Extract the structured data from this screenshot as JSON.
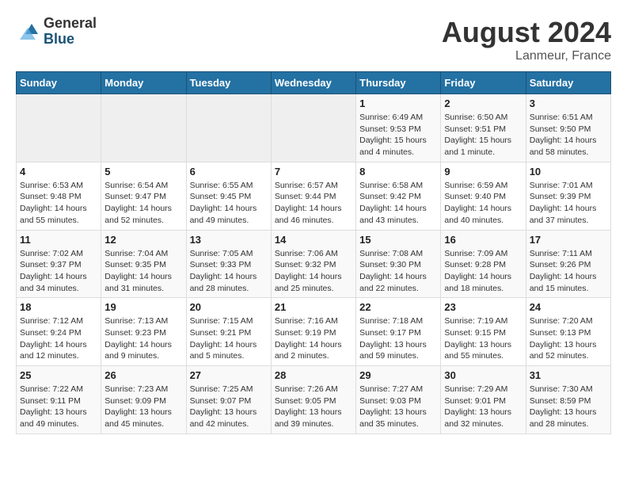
{
  "header": {
    "logo_general": "General",
    "logo_blue": "Blue",
    "month_year": "August 2024",
    "location": "Lanmeur, France"
  },
  "days_of_week": [
    "Sunday",
    "Monday",
    "Tuesday",
    "Wednesday",
    "Thursday",
    "Friday",
    "Saturday"
  ],
  "weeks": [
    {
      "days": [
        {
          "num": "",
          "info": ""
        },
        {
          "num": "",
          "info": ""
        },
        {
          "num": "",
          "info": ""
        },
        {
          "num": "",
          "info": ""
        },
        {
          "num": "1",
          "info": "Sunrise: 6:49 AM\nSunset: 9:53 PM\nDaylight: 15 hours\nand 4 minutes."
        },
        {
          "num": "2",
          "info": "Sunrise: 6:50 AM\nSunset: 9:51 PM\nDaylight: 15 hours\nand 1 minute."
        },
        {
          "num": "3",
          "info": "Sunrise: 6:51 AM\nSunset: 9:50 PM\nDaylight: 14 hours\nand 58 minutes."
        }
      ]
    },
    {
      "days": [
        {
          "num": "4",
          "info": "Sunrise: 6:53 AM\nSunset: 9:48 PM\nDaylight: 14 hours\nand 55 minutes."
        },
        {
          "num": "5",
          "info": "Sunrise: 6:54 AM\nSunset: 9:47 PM\nDaylight: 14 hours\nand 52 minutes."
        },
        {
          "num": "6",
          "info": "Sunrise: 6:55 AM\nSunset: 9:45 PM\nDaylight: 14 hours\nand 49 minutes."
        },
        {
          "num": "7",
          "info": "Sunrise: 6:57 AM\nSunset: 9:44 PM\nDaylight: 14 hours\nand 46 minutes."
        },
        {
          "num": "8",
          "info": "Sunrise: 6:58 AM\nSunset: 9:42 PM\nDaylight: 14 hours\nand 43 minutes."
        },
        {
          "num": "9",
          "info": "Sunrise: 6:59 AM\nSunset: 9:40 PM\nDaylight: 14 hours\nand 40 minutes."
        },
        {
          "num": "10",
          "info": "Sunrise: 7:01 AM\nSunset: 9:39 PM\nDaylight: 14 hours\nand 37 minutes."
        }
      ]
    },
    {
      "days": [
        {
          "num": "11",
          "info": "Sunrise: 7:02 AM\nSunset: 9:37 PM\nDaylight: 14 hours\nand 34 minutes."
        },
        {
          "num": "12",
          "info": "Sunrise: 7:04 AM\nSunset: 9:35 PM\nDaylight: 14 hours\nand 31 minutes."
        },
        {
          "num": "13",
          "info": "Sunrise: 7:05 AM\nSunset: 9:33 PM\nDaylight: 14 hours\nand 28 minutes."
        },
        {
          "num": "14",
          "info": "Sunrise: 7:06 AM\nSunset: 9:32 PM\nDaylight: 14 hours\nand 25 minutes."
        },
        {
          "num": "15",
          "info": "Sunrise: 7:08 AM\nSunset: 9:30 PM\nDaylight: 14 hours\nand 22 minutes."
        },
        {
          "num": "16",
          "info": "Sunrise: 7:09 AM\nSunset: 9:28 PM\nDaylight: 14 hours\nand 18 minutes."
        },
        {
          "num": "17",
          "info": "Sunrise: 7:11 AM\nSunset: 9:26 PM\nDaylight: 14 hours\nand 15 minutes."
        }
      ]
    },
    {
      "days": [
        {
          "num": "18",
          "info": "Sunrise: 7:12 AM\nSunset: 9:24 PM\nDaylight: 14 hours\nand 12 minutes."
        },
        {
          "num": "19",
          "info": "Sunrise: 7:13 AM\nSunset: 9:23 PM\nDaylight: 14 hours\nand 9 minutes."
        },
        {
          "num": "20",
          "info": "Sunrise: 7:15 AM\nSunset: 9:21 PM\nDaylight: 14 hours\nand 5 minutes."
        },
        {
          "num": "21",
          "info": "Sunrise: 7:16 AM\nSunset: 9:19 PM\nDaylight: 14 hours\nand 2 minutes."
        },
        {
          "num": "22",
          "info": "Sunrise: 7:18 AM\nSunset: 9:17 PM\nDaylight: 13 hours\nand 59 minutes."
        },
        {
          "num": "23",
          "info": "Sunrise: 7:19 AM\nSunset: 9:15 PM\nDaylight: 13 hours\nand 55 minutes."
        },
        {
          "num": "24",
          "info": "Sunrise: 7:20 AM\nSunset: 9:13 PM\nDaylight: 13 hours\nand 52 minutes."
        }
      ]
    },
    {
      "days": [
        {
          "num": "25",
          "info": "Sunrise: 7:22 AM\nSunset: 9:11 PM\nDaylight: 13 hours\nand 49 minutes."
        },
        {
          "num": "26",
          "info": "Sunrise: 7:23 AM\nSunset: 9:09 PM\nDaylight: 13 hours\nand 45 minutes."
        },
        {
          "num": "27",
          "info": "Sunrise: 7:25 AM\nSunset: 9:07 PM\nDaylight: 13 hours\nand 42 minutes."
        },
        {
          "num": "28",
          "info": "Sunrise: 7:26 AM\nSunset: 9:05 PM\nDaylight: 13 hours\nand 39 minutes."
        },
        {
          "num": "29",
          "info": "Sunrise: 7:27 AM\nSunset: 9:03 PM\nDaylight: 13 hours\nand 35 minutes."
        },
        {
          "num": "30",
          "info": "Sunrise: 7:29 AM\nSunset: 9:01 PM\nDaylight: 13 hours\nand 32 minutes."
        },
        {
          "num": "31",
          "info": "Sunrise: 7:30 AM\nSunset: 8:59 PM\nDaylight: 13 hours\nand 28 minutes."
        }
      ]
    }
  ]
}
